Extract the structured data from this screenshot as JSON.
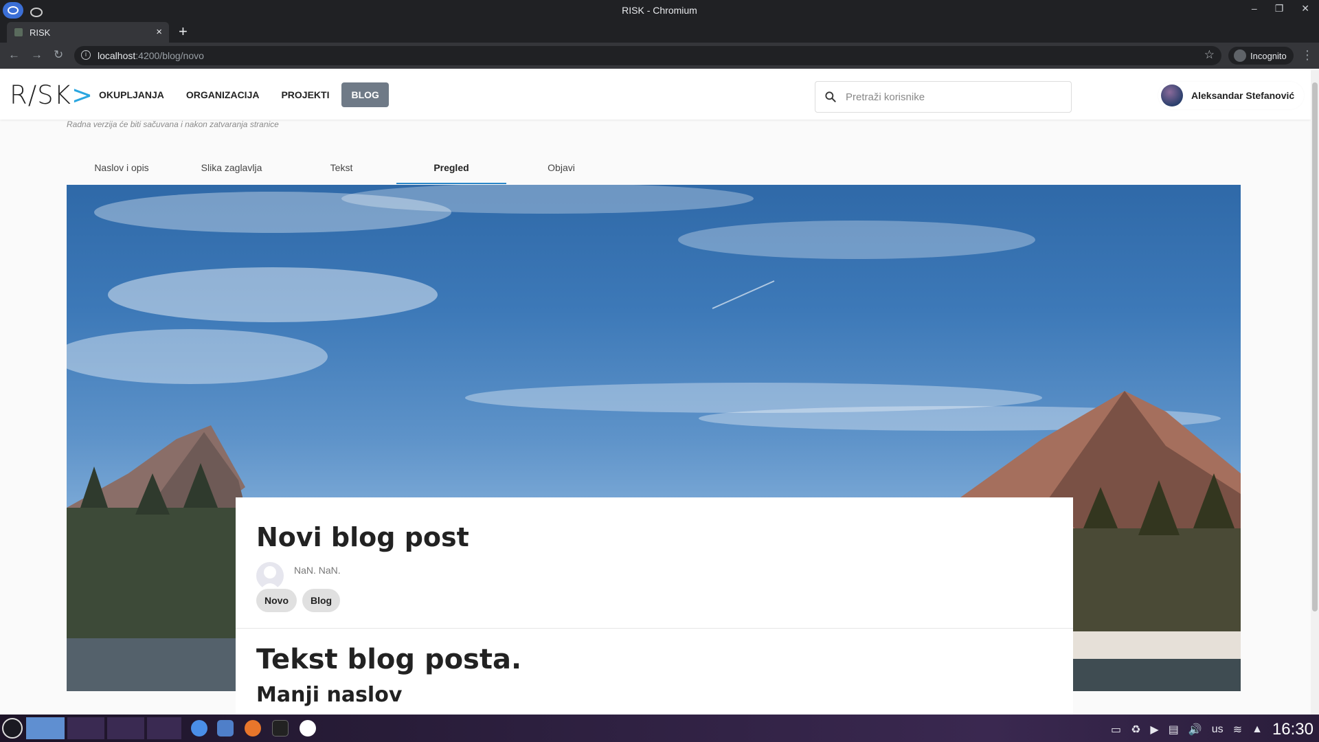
{
  "window": {
    "title": "RISK - Chromium",
    "controls": [
      "–",
      "❐",
      "✕"
    ]
  },
  "browser": {
    "tab_title": "RISK",
    "tab_close": "×",
    "new_tab": "+",
    "url_host": "localhost",
    "url_path": ":4200/blog/novo",
    "incognito_label": "Incognito"
  },
  "header": {
    "logo": "R/SK",
    "nav": [
      "OKUPLJANJA",
      "ORGANIZACIJA",
      "PROJEKTI",
      "BLOG"
    ],
    "active_nav": "BLOG",
    "search_placeholder": "Pretraži korisnike",
    "user_name": "Aleksandar Stefanović"
  },
  "draft_note": "Radna verzija će biti sačuvana i nakon zatvaranja stranice",
  "tabs": [
    "Naslov i opis",
    "Slika zaglavlja",
    "Tekst",
    "Pregled",
    "Objavi"
  ],
  "active_tab": "Pregled",
  "post": {
    "title": "Novi blog post",
    "date": "NaN. NaN.",
    "tags": [
      "Novo",
      "Blog"
    ],
    "body_h1": "Tekst blog posta.",
    "body_h2": "Manji naslov"
  },
  "taskbar": {
    "keyboard": "us",
    "clock": "16:30"
  },
  "colors": {
    "nav_active_bg": "#6f7a87",
    "tab_indicator": "#2a86c8",
    "logo_accent": "#2aa6e0"
  }
}
